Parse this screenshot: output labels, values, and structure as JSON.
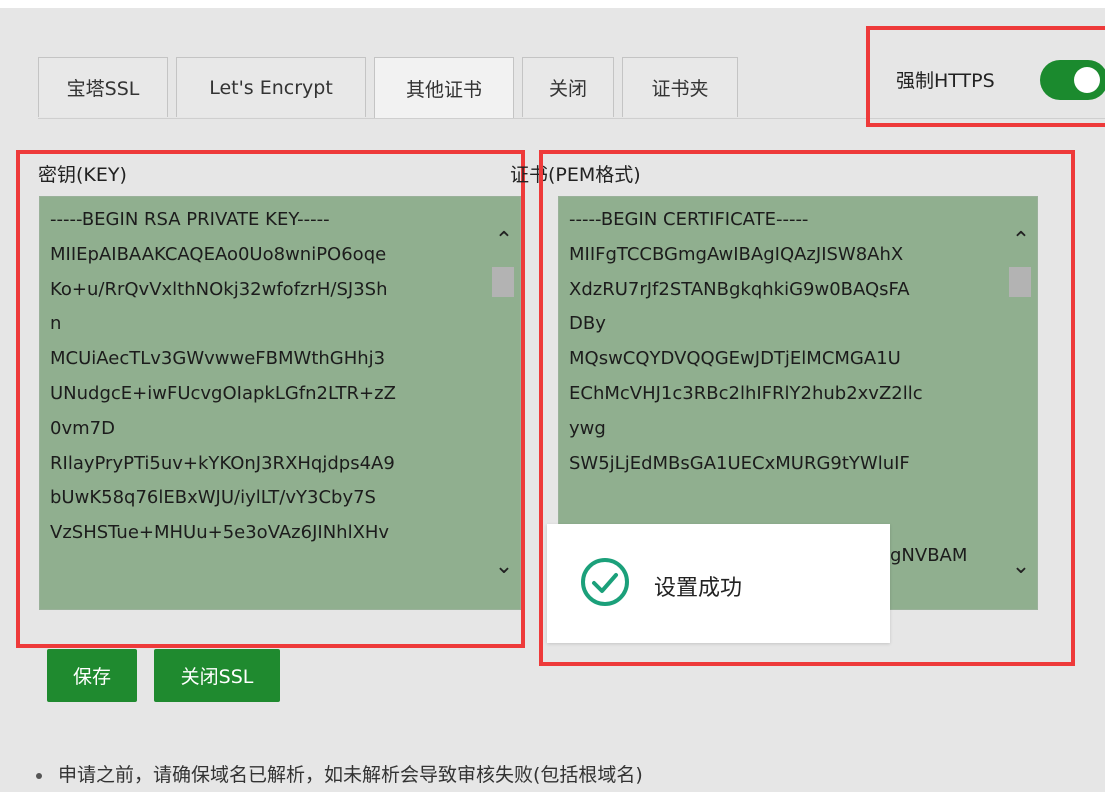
{
  "tabs": [
    {
      "label": "宝塔SSL",
      "active": false
    },
    {
      "label": "Let's Encrypt",
      "active": false
    },
    {
      "label": "其他证书",
      "active": true
    },
    {
      "label": "关闭",
      "active": false
    },
    {
      "label": "证书夹",
      "active": false
    }
  ],
  "force_https": {
    "label": "强制HTTPS",
    "enabled": true
  },
  "key_panel": {
    "label": "密钥(KEY)",
    "lines": [
      "-----BEGIN RSA PRIVATE KEY-----",
      "MIIEpAIBAAKCAQEAo0Uo8wniPO6oqe",
      "Ko+u/RrQvVxlthNOkj32wfofzrH/SJ3Sh",
      "n",
      "MCUiAecTLv3GWvwweFBMWthGHhj3",
      "UNudgcE+iwFUcvgOIapkLGfn2LTR+zZ",
      "0vm7D",
      "RIlayPryPTi5uv+kYKOnJ3RXHqjdps4A9",
      "bUwK58q76lEBxWJU/iylLT/vY3Cby7S",
      "VzSHSTue+MHUu+5e3oVAz6JINhlXHv"
    ]
  },
  "cert_panel": {
    "label": "证书(PEM格式)",
    "lines": [
      "-----BEGIN CERTIFICATE-----",
      "MIIFgTCCBGmgAwIBAgIQAzJISW8AhX",
      "XdzRU7rJf2STANBgkqhkiG9w0BAQsFA",
      "DBy",
      "MQswCQYDVQQGEwJDTjElMCMGA1U",
      "EChMcVHJ1c3RBc2lhIFRlY2hub2xvZ2llc",
      "ywg",
      "SW5jLjEdMBsGA1UECxMURG9tYWluIF",
      "",
      ""
    ],
    "partial_line_right": "gNVBAM"
  },
  "buttons": {
    "save": "保存",
    "close_ssl": "关闭SSL"
  },
  "toast": {
    "message": "设置成功",
    "icon": "check-circle-icon"
  },
  "note": "申请之前，请确保域名已解析，如未解析会导致审核失败(包括根域名)",
  "colors": {
    "accent": "#1f8a2f",
    "textarea_bg": "#90af8f",
    "annotation": "#ee3a3a"
  }
}
